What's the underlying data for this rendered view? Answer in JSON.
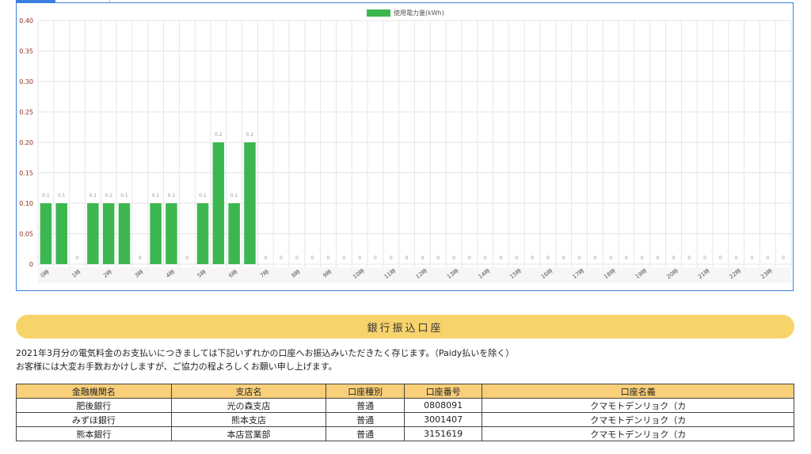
{
  "chart_data": {
    "type": "bar",
    "legend": "使用電力量(kWh)",
    "legend_position": "top",
    "grid": true,
    "ylim": [
      0,
      0.4
    ],
    "y_ticks": [
      "0",
      "0.05",
      "0.10",
      "0.15",
      "0.20",
      "0.25",
      "0.30",
      "0.35",
      "0.40"
    ],
    "x_tick_labels": [
      "0時",
      "1時",
      "2時",
      "3時",
      "4時",
      "5時",
      "6時",
      "7時",
      "8時",
      "9時",
      "10時",
      "11時",
      "12時",
      "13時",
      "14時",
      "15時",
      "16時",
      "17時",
      "18時",
      "19時",
      "20時",
      "21時",
      "22時",
      "23時"
    ],
    "series": [
      {
        "values": [
          0.1,
          0.1,
          0,
          0.1,
          0.1,
          0.1,
          0,
          0.1,
          0.1,
          0,
          0.1,
          0.2,
          0.1,
          0.2,
          0,
          0,
          0,
          0,
          0,
          0,
          0,
          0,
          0,
          0,
          0,
          0,
          0,
          0,
          0,
          0,
          0,
          0,
          0,
          0,
          0,
          0,
          0,
          0,
          0,
          0,
          0,
          0,
          0,
          0,
          0,
          0,
          0,
          0
        ],
        "value_labels": [
          "0.1",
          "0.1",
          "0",
          "0.1",
          "0.1",
          "0.1",
          "0",
          "0.1",
          "0.1",
          "0",
          "0.1",
          "0.2",
          "0.1",
          "0.2",
          "0",
          "0",
          "0",
          "0",
          "0",
          "0",
          "0",
          "0",
          "0",
          "0",
          "0",
          "0",
          "0",
          "0",
          "0",
          "0",
          "0",
          "0",
          "0",
          "0",
          "0",
          "0",
          "0",
          "0",
          "0",
          "0",
          "0",
          "0",
          "0",
          "0",
          "0",
          "0",
          "0",
          "0"
        ]
      }
    ],
    "colors": {
      "bar": "#3cb750",
      "grid": "#e6e6e6",
      "axis_text": "#8b2d1a",
      "value_text": "#999999"
    }
  },
  "section_title": "銀行振込口座",
  "notice_lines": [
    "2021年3月分の電気料金のお支払いにつきましては下記いずれかの口座へお振込みいただきたく存じます。（Paidy払いを除く）",
    "お客様には大変お手数おかけしますが、ご協力の程よろしくお願い申し上げます。"
  ],
  "bank_table": {
    "headers": [
      "金融機関名",
      "支店名",
      "口座種別",
      "口座番号",
      "口座名義"
    ],
    "rows": [
      [
        "肥後銀行",
        "光の森支店",
        "普通",
        "0808091",
        "クマモトデンリョク（カ"
      ],
      [
        "みずほ銀行",
        "熊本支店",
        "普通",
        "3001407",
        "クマモトデンリョク（カ"
      ],
      [
        "熊本銀行",
        "本店営業部",
        "普通",
        "3151619",
        "クマモトデンリョク（カ"
      ]
    ],
    "header_color": "#f9cf79"
  },
  "colors": {
    "accent": "#3d7fe0",
    "banner": "#f7d36b"
  }
}
